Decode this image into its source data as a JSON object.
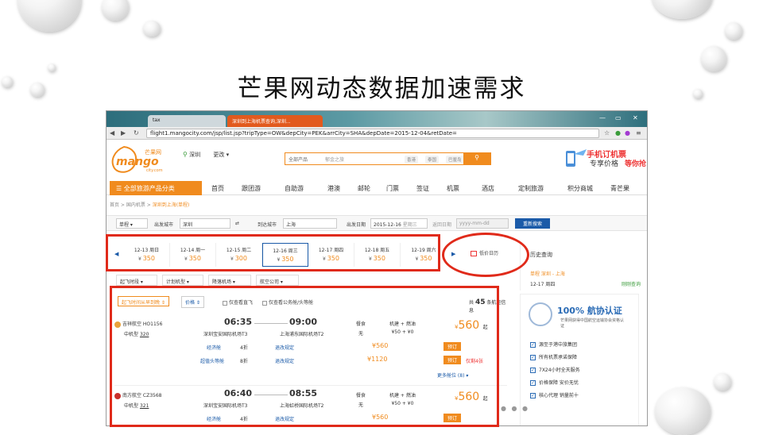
{
  "slide_title": "芒果网动态数据加速需求",
  "browser": {
    "tab1": "tax",
    "tab2": "深圳到上海机票查询,深圳...",
    "url": "flight1.mangocity.com/jsp/list.jsp?tripType=OW&depCity=PEK&arrCity=SHA&depDate=2015-12-04&retDate="
  },
  "logo": {
    "main": "mango",
    "cn": "芒果网",
    "sub": "city.com"
  },
  "location": {
    "city": "深圳",
    "change": "更改"
  },
  "search": {
    "category": "全部产品",
    "placeholder": "郁金之旅",
    "chips": [
      "香港",
      "泰国",
      "巴厘岛"
    ]
  },
  "promo": {
    "line1": "手机订机票",
    "line2": "专享价格",
    "line3": "等你抢"
  },
  "menu": {
    "all": "全部旅游产品分类",
    "items": [
      "首页",
      "跟团游",
      "自助游",
      "港澳",
      "邮轮",
      "门票",
      "签证",
      "机票",
      "酒店",
      "定制旅游",
      "积分商城",
      "青芒果"
    ]
  },
  "breadcrumb": {
    "home": "首页",
    "mid": "国内机票",
    "current": "深圳到上海(单程)"
  },
  "conditions": {
    "trip": "单程",
    "dep_label": "出发城市",
    "dep_city": "深圳",
    "arr_label": "到达城市",
    "arr_city": "上海",
    "date_label": "出发日期",
    "date": "2015-12-16",
    "weekday": "星期三",
    "ret_label": "返回日期",
    "ret_ph": "yyyy-mm-dd",
    "search_btn": "重新搜索"
  },
  "date_strip": [
    {
      "date": "12-13 周日",
      "price": "350"
    },
    {
      "date": "12-14 周一",
      "price": "350"
    },
    {
      "date": "12-15 周二",
      "price": "300"
    },
    {
      "date": "12-16 周三",
      "price": "350"
    },
    {
      "date": "12-17 周四",
      "price": "350"
    },
    {
      "date": "12-18 周五",
      "price": "350"
    },
    {
      "date": "12-19 周六",
      "price": "350"
    }
  ],
  "low_calendar": "低价日历",
  "history": {
    "title": "历史查询",
    "route": "单程 深圳 - 上海",
    "date": "12-17 周四",
    "link": "刚刚查询"
  },
  "filters": [
    "起飞时段",
    "计划机型",
    "降落机场",
    "航空公司"
  ],
  "sort": {
    "time": "起飞时间从早到晚",
    "price": "价格",
    "direct": "仅查看直飞",
    "nonbiz": "仅查看公务舱/头等舱",
    "count_pre": "共",
    "count": "45",
    "count_post": "条航班信息"
  },
  "flights": [
    {
      "airline": "吉祥航空 HO1156",
      "model_label": "中机型",
      "model": "320",
      "dep_time": "06:35",
      "arr_time": "09:00",
      "dep_ap": "深圳宝安国际机场T3",
      "arr_ap": "上海浦东国际机场T2",
      "meal_label": "餐食",
      "meal": "无",
      "fee_label": "机建 + 燃油",
      "fee": "¥50 + ¥0",
      "price": "560",
      "price_suffix": "起",
      "rows": [
        {
          "cabin": "经济舱",
          "disc": "4折",
          "rule": "退改规定",
          "price": "560",
          "book": "预订",
          "extra": ""
        },
        {
          "cabin": "超值头等舱",
          "disc": "8折",
          "rule": "退改规定",
          "price": "1120",
          "book": "预订",
          "extra": "仅剩4张"
        }
      ],
      "more": "更多舱位 (8)"
    },
    {
      "airline": "南方航空 CZ3568",
      "model_label": "中机型",
      "model": "321",
      "dep_time": "06:40",
      "arr_time": "08:55",
      "dep_ap": "深圳宝安国际机场T3",
      "arr_ap": "上海虹桥国际机场T2",
      "meal_label": "餐食",
      "meal": "无",
      "fee_label": "机建 + 燃油",
      "fee": "¥50 + ¥0",
      "price": "560",
      "price_suffix": "起",
      "rows": [
        {
          "cabin": "经济舱",
          "disc": "4折",
          "rule": "退改规定",
          "price": "560",
          "book": "预订",
          "extra": ""
        }
      ]
    }
  ],
  "side": {
    "cert": "100% 航协认证",
    "cert_sub": "芒果网获得中国航空运输协会资格认证",
    "items": [
      "源至于港中旅集团",
      "所有机票承诺保障",
      "7X24小时全天服务",
      "价格保障 安价无忧",
      "核心代理 销量前十"
    ]
  },
  "colors": {
    "brand": "#f08b1e",
    "link": "#1a5aa8",
    "highlight": "#e02a1a"
  }
}
